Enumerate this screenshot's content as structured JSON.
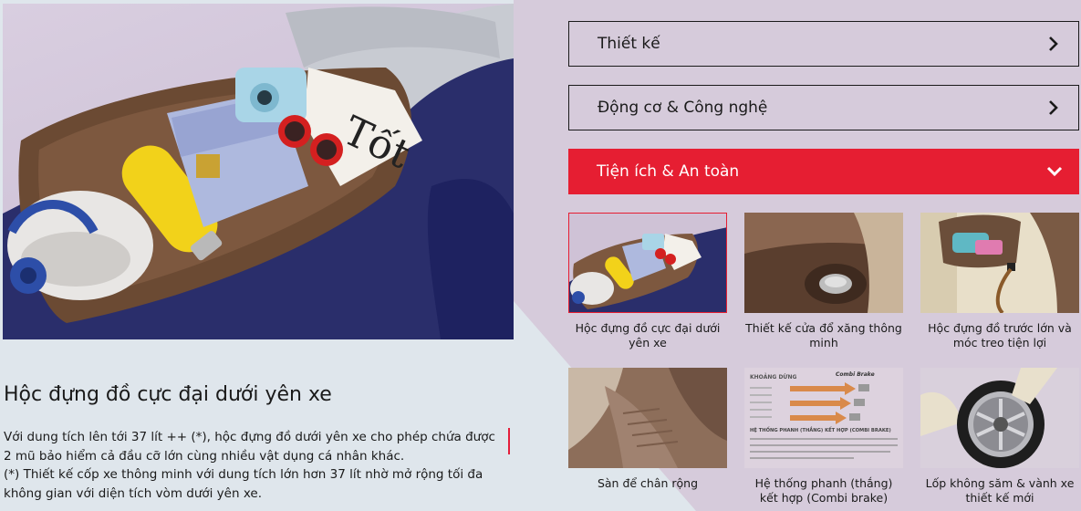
{
  "accordion": [
    {
      "label": "Thiết kế",
      "state": "closed",
      "icon": "chevron-right-icon"
    },
    {
      "label": "Động cơ & Công nghệ",
      "state": "closed",
      "icon": "chevron-right-icon"
    },
    {
      "label": "Tiện ích & An toàn",
      "state": "open",
      "icon": "chevron-down-icon"
    }
  ],
  "detail": {
    "title": "Hộc đựng đồ cực đại dưới yên xe",
    "paragraphs": [
      "Với dung tích lên tới 37 lít ++ (*), hộc đựng đồ dưới yên xe cho phép chứa được 2 mũ bảo hiểm cả đầu cỡ lớn cùng nhiều vật dụng cá nhân khác.",
      "(*) Thiết kế cốp xe thông minh với dung tích lớn hơn 37 lít nhờ mở rộng tối đa không gian với diện tích vòm dưới yên xe."
    ]
  },
  "features": [
    {
      "caption": "Hộc đựng đồ cực đại dưới yên xe",
      "active": true
    },
    {
      "caption": "Thiết kế cửa đổ xăng thông minh",
      "active": false
    },
    {
      "caption": "Hộc đựng đồ trước lớn và móc treo tiện lợi",
      "active": false
    },
    {
      "caption": "Sàn để chân rộng",
      "active": false
    },
    {
      "caption": "Hệ thống phanh (thắng) kết hợp (Combi brake)",
      "active": false
    },
    {
      "caption": "Lốp không săm & vành xe thiết kế mới",
      "active": false
    }
  ],
  "brake_thumb": {
    "heading": "KHOẢNG DỪNG",
    "brand": "Combi Brake",
    "section": "HỆ THỐNG PHANH (THẮNG) KẾT HỢP (COMBI BRAKE)"
  },
  "hero_magazine_text": "Tốt",
  "colors": {
    "accent": "#e61e32",
    "text": "#1a1a1a"
  }
}
